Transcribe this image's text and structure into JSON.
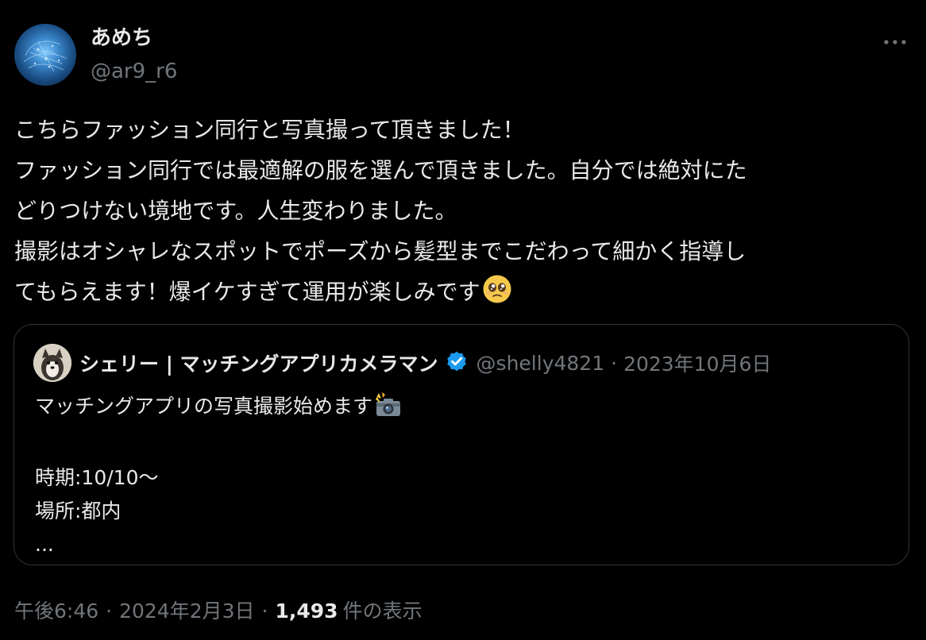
{
  "author": {
    "display_name": "あめち",
    "handle": "@ar9_r6"
  },
  "post": {
    "lines": [
      "こちらファッション同行と写真撮って頂きました！",
      "ファッション同行では最適解の服を選んで頂きました。自分では絶対にた",
      "どりつけない境地です。人生変わりました。",
      "撮影はオシャレなスポットでポーズから髪型までこだわって細かく指導し",
      "てもらえます！爆イケすぎて運用が楽しみです"
    ],
    "trailing_emoji": "pleading-face-emoji"
  },
  "quoted_post": {
    "display_name": "シェリー | マッチングアプリカメラマン",
    "verified": true,
    "handle": "@shelly4821",
    "separator": "·",
    "date": "2023年10月6日",
    "lines": [
      "マッチングアプリの写真撮影始めます",
      "",
      "時期:10/10〜",
      "場所:都内",
      "..."
    ],
    "emoji": "camera-with-flash-emoji"
  },
  "footer": {
    "time": "午後6:46",
    "sep1": "·",
    "date": "2024年2月3日",
    "sep2": "·",
    "views_count": "1,493",
    "views_label": "件の表示"
  },
  "icons": {
    "more": "more-horizontal-icon",
    "verified": "verified-badge-icon"
  },
  "colors": {
    "background": "#000000",
    "primary_text": "#e7e9ea",
    "secondary_text": "#71767b",
    "border": "#2f3336",
    "verified_blue": "#1d9bf0"
  }
}
